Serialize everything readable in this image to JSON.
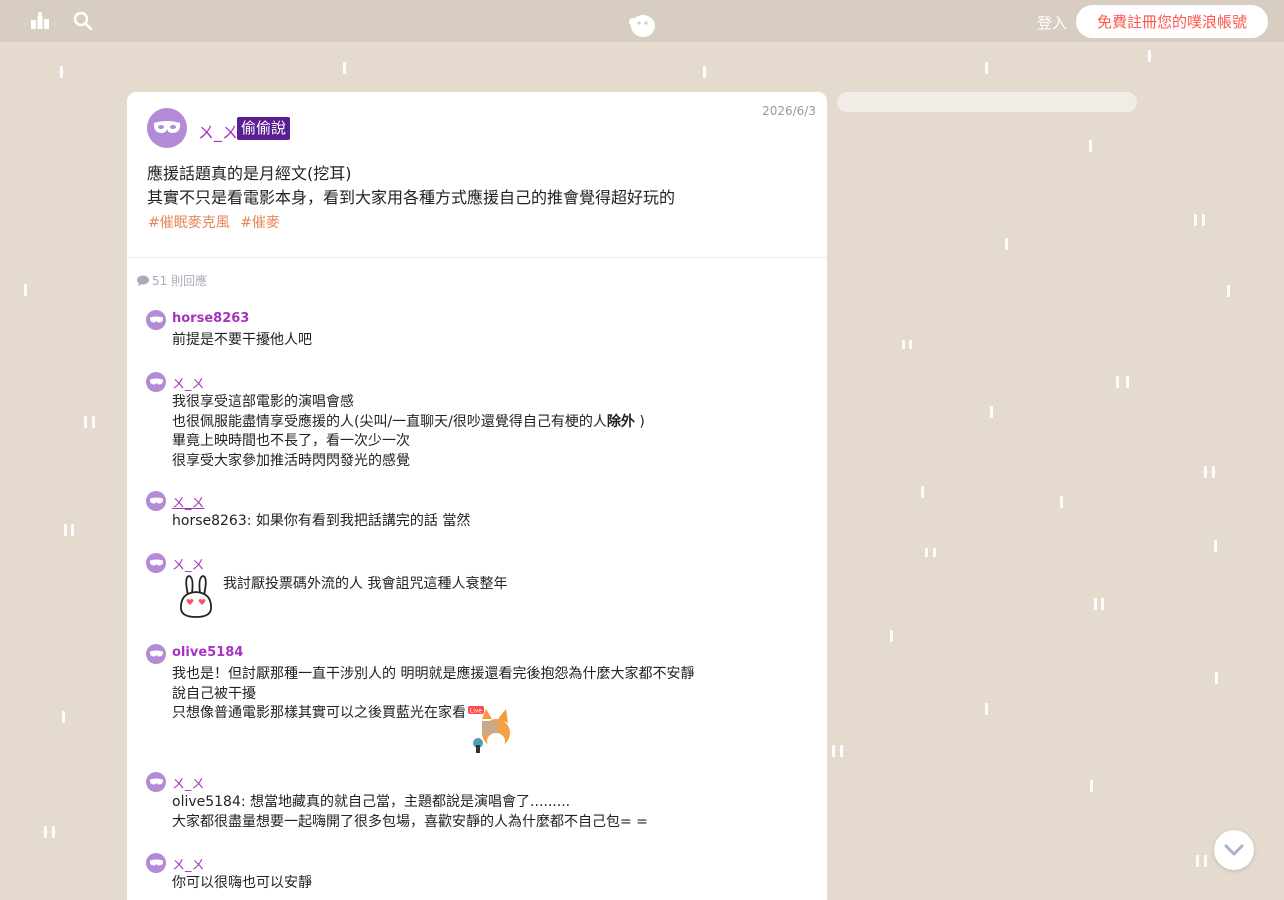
{
  "topbar": {
    "login_label": "登入",
    "register_label": "免費註冊您的噗浪帳號"
  },
  "post": {
    "author": "ㄨ_ㄨ",
    "badge": "偷偷說",
    "date": "2026/6/3",
    "lines": [
      "應援話題真的是月經文(挖耳)",
      "其實不只是看電影本身，看到大家用各種方式應援自己的推會覺得超好玩的"
    ],
    "tags": [
      "#催眠麥克風",
      "#催麥"
    ]
  },
  "responses_count": "51 則回應",
  "responses": [
    {
      "name": "horse8263",
      "lines": [
        "前提是不要干擾他人吧"
      ]
    },
    {
      "name": "ㄨ_ㄨ",
      "lines": [
        "我很享受這部電影的演唱會感",
        "也很佩服能盡情享受應援的人(尖叫/一直聊天/很吵還覺得自己有梗的人",
        "畢竟上映時間也不長了，看一次少一次",
        "很享受大家參加推活時閃閃發光的感覺"
      ],
      "bold": "除外",
      "tail": " )"
    },
    {
      "name": "ㄨ_ㄨ",
      "lines": [
        "horse8263: 如果你有看到我把話講完的話 當然"
      ]
    },
    {
      "name": "ㄨ_ㄨ",
      "lines": [
        "我討厭投票碼外流的人 我會詛咒這種人衰整年"
      ]
    },
    {
      "name": "olive5184",
      "lines": [
        "我也是！但討厭那種一直干涉別人的 明明就是應援還看完後抱怨為什麼大家都不安靜",
        "說自己被干擾",
        "只想像普通電影那樣其實可以之後買藍光在家看"
      ]
    },
    {
      "name": "ㄨ_ㄨ",
      "lines": [
        "olive5184: 想當地藏真的就自己當，主題都說是演唱會了.........",
        "大家都很盡量想要一起嗨開了很多包場，喜歡安靜的人為什麼都不自己包= ="
      ]
    },
    {
      "name": "ㄨ_ㄨ",
      "lines": [
        "你可以很嗨也可以安靜"
      ]
    }
  ],
  "sticker_live_label": "Live",
  "icons": {
    "top_left": "ranking-icon",
    "search": "search-icon",
    "logo": "plurk-logo-icon",
    "avatar": "mask-avatar-icon",
    "comment": "comment-icon",
    "scroll": "chevron-down-icon"
  },
  "colors": {
    "background": "#e4dacd",
    "accent_name": "#a633c1",
    "badge": "#5c1f92",
    "tag": "#e3865a",
    "register_text": "#ff574d"
  }
}
